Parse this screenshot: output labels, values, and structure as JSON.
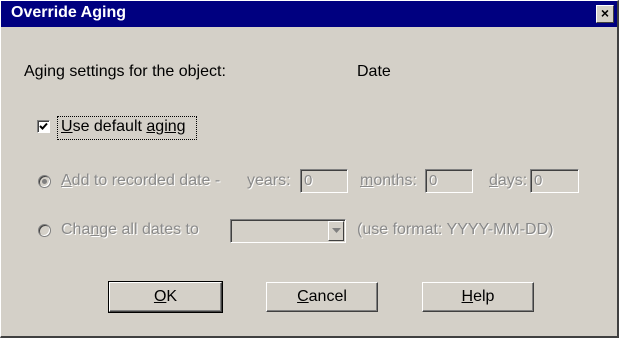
{
  "window": {
    "title": "Override Aging",
    "close_glyph": "×"
  },
  "object_row": {
    "label": "Aging settings for the object:",
    "value": "Date"
  },
  "use_default": {
    "label_access": "U",
    "label_rest": "se default ",
    "label_tail_underlined": "aging",
    "checked": true
  },
  "add_option": {
    "label_prefix": "",
    "label_access": "A",
    "label_rest": "dd to recorded date -",
    "selected": true,
    "enabled": false,
    "years": {
      "label": "years:",
      "value": "0"
    },
    "months": {
      "label_access": "m",
      "label_rest": "onths:",
      "value": "0"
    },
    "days": {
      "label_access": "d",
      "label_rest": "ays:",
      "value": "0"
    }
  },
  "change_option": {
    "label_prefix": "Cha",
    "label_access": "n",
    "label_rest": "ge all dates to",
    "selected": false,
    "enabled": false,
    "date_value": "",
    "format_hint": "(use format: YYYY-MM-DD)"
  },
  "buttons": {
    "ok": {
      "access": "O",
      "rest": "K"
    },
    "cancel": {
      "access": "C",
      "rest": "ancel"
    },
    "help": {
      "access": "H",
      "rest": "elp"
    }
  },
  "colors": {
    "titlebar": "#000080",
    "face": "#d4d0c8",
    "disabled_text": "#8a8a8a"
  },
  "icons": {
    "close": "close-icon",
    "check": "checkmark-icon",
    "dropdown": "chevron-down-icon"
  }
}
